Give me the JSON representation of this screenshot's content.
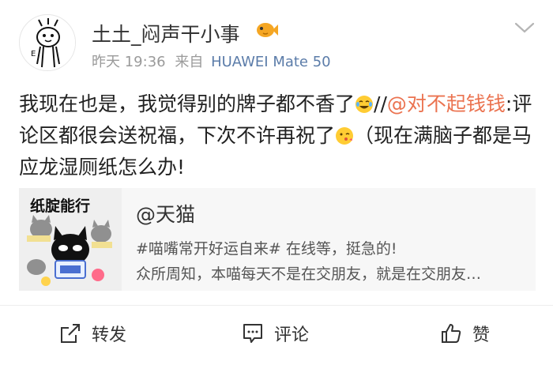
{
  "post": {
    "username": "土土_闷声干小事",
    "time": "昨天 19:36",
    "source_prefix": "来自",
    "device": "HUAWEI Mate 50",
    "content": {
      "part1": "我现在也是，我觉得别的牌子都不香了",
      "part2": "//",
      "mention": "@对不起钱钱",
      "part3": ":评论区都很会送祝福，下次不许再祝了",
      "part4": "（现在满脑子都是马应龙湿厕纸怎么办!"
    }
  },
  "card": {
    "thumb_title": "纸腚能行",
    "title": "@天猫",
    "line1": "#喵嘴常开好运自来# 在线等，挺急的!",
    "line2": "众所周知，本喵每天不是在交朋友，就是在交朋友…"
  },
  "actions": {
    "repost": "转发",
    "comment": "评论",
    "like": "赞"
  },
  "icons": {
    "avatar": "avatar-doodle",
    "badge": "fish-icon",
    "more": "chevron-down-icon",
    "emoji1": "laugh-cry-emoji",
    "emoji2": "kiss-emoji",
    "repost": "share-icon",
    "comment": "comment-icon",
    "like": "thumbs-up-icon"
  },
  "colors": {
    "mention": "#eb7350",
    "device": "#5b7ca9",
    "meta": "#9a9a9a"
  }
}
